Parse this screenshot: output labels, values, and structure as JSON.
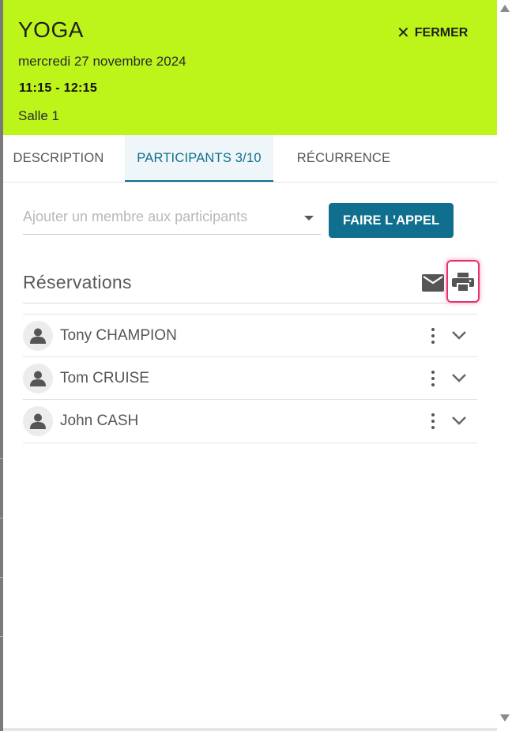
{
  "header": {
    "title": "YOGA",
    "date": "mercredi 27 novembre 2024",
    "time": "11:15 - 12:15",
    "room": "Salle 1",
    "close_label": "FERMER",
    "background_color": "#bdf51b"
  },
  "tabs": [
    {
      "label": "DESCRIPTION",
      "active": false
    },
    {
      "label": "PARTICIPANTS 3/10",
      "active": true
    },
    {
      "label": "RÉCURRENCE",
      "active": false
    }
  ],
  "add_member": {
    "placeholder": "Ajouter un membre aux participants"
  },
  "call_button": {
    "label": "FAIRE L'APPEL",
    "color": "#106f8e"
  },
  "reservations": {
    "title": "Réservations",
    "icons": [
      "mail-icon",
      "print-icon"
    ],
    "highlight_color": "#e8336a",
    "participants": [
      {
        "name": "Tony CHAMPION"
      },
      {
        "name": "Tom CRUISE"
      },
      {
        "name": "John CASH"
      }
    ]
  }
}
